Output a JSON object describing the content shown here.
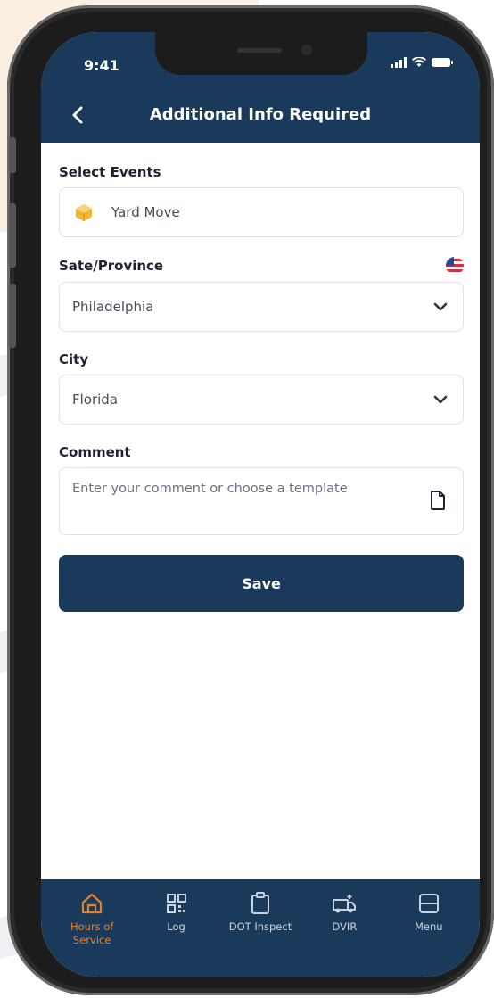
{
  "status_bar": {
    "time": "9:41",
    "icons": [
      "signal-icon",
      "wifi-icon",
      "battery-icon"
    ]
  },
  "header": {
    "back_icon": "chevron-left-icon",
    "title": "Additional Info Required"
  },
  "form": {
    "select_events": {
      "label": "Select Events",
      "value": "Yard Move",
      "icon": "yard-move-icon"
    },
    "state": {
      "label": "Sate/Province",
      "value": "Philadelphia",
      "flag_icon": "us-flag-icon"
    },
    "city": {
      "label": "City",
      "value": "Florida"
    },
    "comment": {
      "label": "Comment",
      "placeholder": "Enter your comment or choose a template",
      "icon": "document-icon"
    },
    "save_label": "Save"
  },
  "bottom_nav": {
    "items": [
      {
        "label": "Hours of Service",
        "icon": "home-icon",
        "active": true
      },
      {
        "label": "Log",
        "icon": "qr-code-icon",
        "active": false
      },
      {
        "label": "DOT Inspect",
        "icon": "clipboard-icon",
        "active": false
      },
      {
        "label": "DVIR",
        "icon": "truck-icon",
        "active": false
      },
      {
        "label": "Menu",
        "icon": "menu-icon",
        "active": false
      }
    ]
  },
  "colors": {
    "primary": "#1a3a5c",
    "active_nav": "#e0832b",
    "event_icon": "#f2b632",
    "flag_red": "#d62d3a"
  }
}
